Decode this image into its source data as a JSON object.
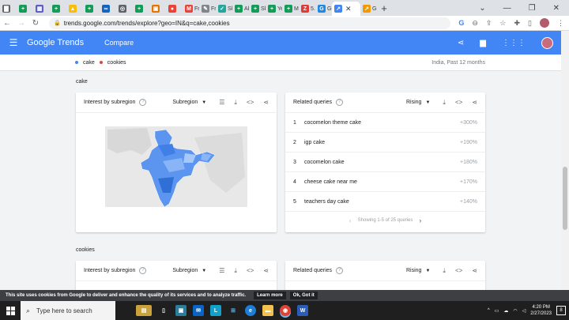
{
  "browser": {
    "tabs": [
      {
        "label": "",
        "color": "#5f6368",
        "glyph": "▇"
      },
      {
        "label": "",
        "color": "#0f9d58",
        "glyph": "+"
      },
      {
        "label": "",
        "color": "#5b5fc7",
        "glyph": "▦"
      },
      {
        "label": "",
        "color": "#0f9d58",
        "glyph": "+"
      },
      {
        "label": "",
        "color": "#fbbc04",
        "glyph": "▲"
      },
      {
        "label": "",
        "color": "#0f9d58",
        "glyph": "+"
      },
      {
        "label": "",
        "color": "#1565c0",
        "glyph": "∞"
      },
      {
        "label": "",
        "color": "#5f6368",
        "glyph": "◎"
      },
      {
        "label": "",
        "color": "#0f9d58",
        "glyph": "+"
      },
      {
        "label": "",
        "color": "#e37400",
        "glyph": "▣"
      },
      {
        "label": "",
        "color": "#ea4335",
        "glyph": "●"
      },
      {
        "label": "Fre",
        "color": "#ea4335",
        "glyph": "M"
      },
      {
        "label": "Fre",
        "color": "#80868b",
        "glyph": "✎"
      },
      {
        "label": "Ski",
        "color": "#26a69a",
        "glyph": "✓"
      },
      {
        "label": "Ak",
        "color": "#0f9d58",
        "glyph": "+"
      },
      {
        "label": "Ski",
        "color": "#0f9d58",
        "glyph": "+"
      },
      {
        "label": "Yel",
        "color": "#0f9d58",
        "glyph": "+"
      },
      {
        "label": "Ma",
        "color": "#0f9d58",
        "glyph": "+"
      },
      {
        "label": "5.1",
        "color": "#e53935",
        "glyph": "Z"
      },
      {
        "label": "Go",
        "color": "#1e88e5",
        "glyph": "G"
      },
      {
        "label": "",
        "color": "#4285f4",
        "glyph": "↗",
        "active": true
      },
      {
        "label": "Go",
        "color": "#f29900",
        "glyph": "↗"
      }
    ],
    "url": "trends.google.com/trends/explore?geo=IN&q=cake,cookies"
  },
  "header": {
    "logo_google": "Google",
    "logo_trends": "Trends",
    "compare": "Compare"
  },
  "legend": {
    "terms": [
      {
        "label": "cake",
        "color": "#4285f4"
      },
      {
        "label": "cookies",
        "color": "#ea4335"
      }
    ],
    "scope": "India, Past 12 months"
  },
  "sections": {
    "cake": {
      "title": "cake",
      "interest_title": "Interest by subregion",
      "subregion_select": "Subregion",
      "related_title": "Related queries",
      "rising_select": "Rising",
      "queries": [
        {
          "rank": "1",
          "label": "cocomelon theme cake",
          "value": "+300%"
        },
        {
          "rank": "2",
          "label": "igp cake",
          "value": "+190%"
        },
        {
          "rank": "3",
          "label": "cocomelon cake",
          "value": "+180%"
        },
        {
          "rank": "4",
          "label": "cheese cake near me",
          "value": "+170%"
        },
        {
          "rank": "5",
          "label": "teachers day cake",
          "value": "+140%"
        }
      ],
      "pager": "Showing 1-5 of 25 queries"
    },
    "cookies": {
      "title": "cookies",
      "interest_title": "Interest by subregion",
      "subregion_select": "Subregion",
      "related_title": "Related queries",
      "rising_select": "Rising"
    }
  },
  "cookie_bar": {
    "text": "This site uses cookies from Google to deliver and enhance the quality of its services and to analyze traffic.",
    "learn_more": "Learn more",
    "ok": "Ok, Got it"
  },
  "taskbar": {
    "search_placeholder": "Type here to search",
    "time": "4:20 PM",
    "date": "2/27/2023",
    "notification_count": "8"
  }
}
